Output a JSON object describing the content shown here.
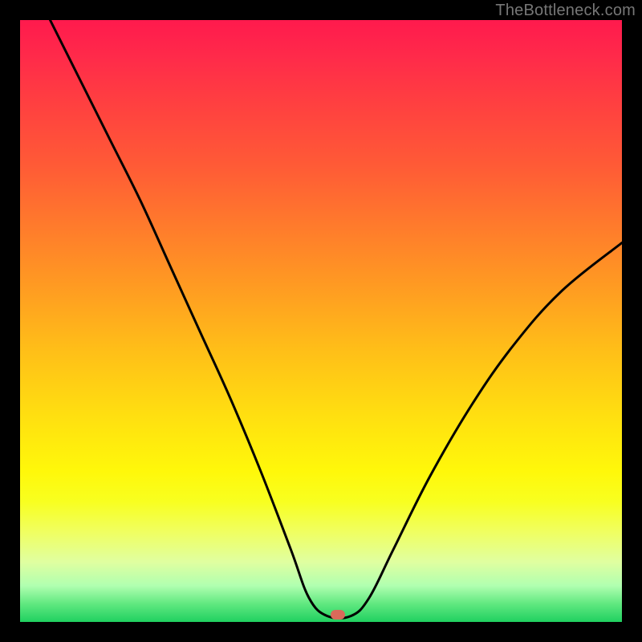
{
  "watermark": "TheBottleneck.com",
  "marker": {
    "color": "#d96a5a",
    "x_frac": 0.528,
    "y_frac": 0.988
  },
  "chart_data": {
    "type": "line",
    "title": "",
    "xlabel": "",
    "ylabel": "",
    "xlim": [
      0,
      1
    ],
    "ylim": [
      0,
      1
    ],
    "series": [
      {
        "name": "bottleneck-curve",
        "x": [
          0.05,
          0.1,
          0.15,
          0.2,
          0.25,
          0.3,
          0.35,
          0.4,
          0.45,
          0.48,
          0.51,
          0.55,
          0.58,
          0.62,
          0.68,
          0.75,
          0.82,
          0.9,
          1.0
        ],
        "y": [
          1.0,
          0.9,
          0.8,
          0.7,
          0.59,
          0.48,
          0.37,
          0.25,
          0.12,
          0.04,
          0.01,
          0.01,
          0.04,
          0.12,
          0.24,
          0.36,
          0.46,
          0.55,
          0.63
        ]
      }
    ],
    "annotations": [
      {
        "text": "TheBottleneck.com",
        "position": "top-right"
      }
    ],
    "optimum_x": 0.528
  }
}
